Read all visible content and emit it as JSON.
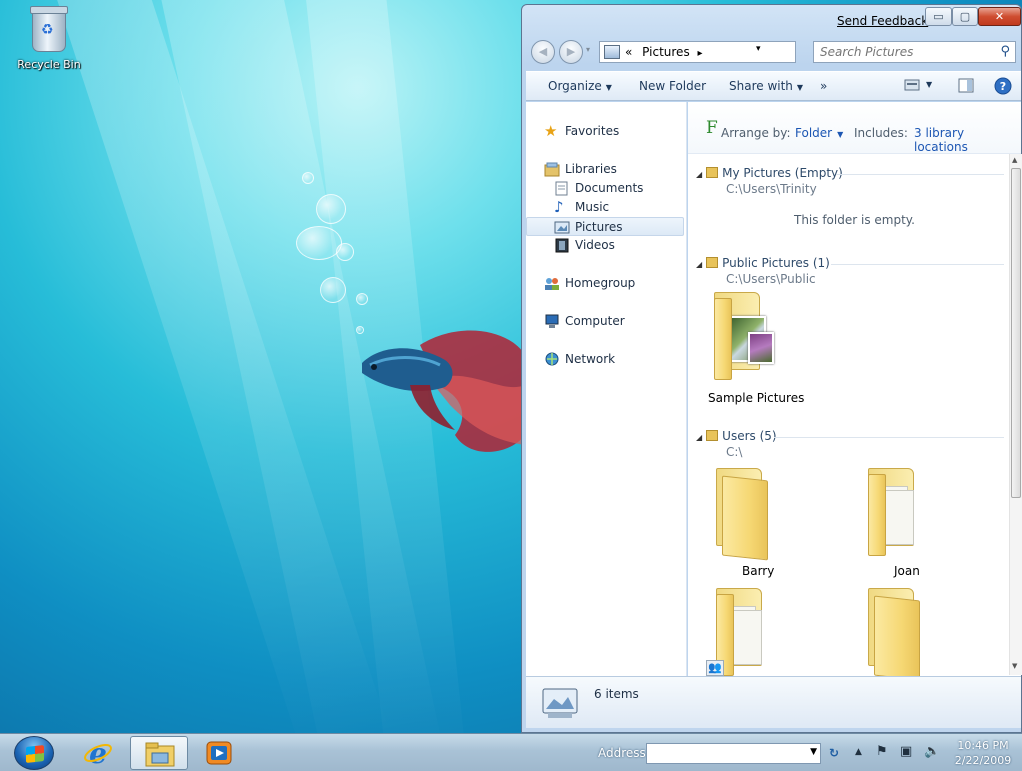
{
  "desktop": {
    "recycle_bin_label": "Recycle Bin"
  },
  "window": {
    "send_feedback": "Send Feedback",
    "caption_buttons": {
      "minimize": "▭",
      "maximize": "▢",
      "close": "✕"
    },
    "nav": {
      "back": "◀",
      "forward": "▶"
    },
    "address": {
      "prefix": "«",
      "location": "Pictures",
      "separator": "▸",
      "dropdown": "▾",
      "refresh": "↻"
    },
    "search": {
      "placeholder": "Search Pictures"
    },
    "toolbar": {
      "organize": "Organize",
      "new_folder": "New Folder",
      "share_with": "Share with",
      "more": "»"
    },
    "nav_pane": {
      "favorites": "Favorites",
      "libraries": "Libraries",
      "documents": "Documents",
      "music": "Music",
      "pictures": "Pictures",
      "videos": "Videos",
      "homegroup": "Homegroup",
      "computer": "Computer",
      "network": "Network"
    },
    "library_header": {
      "letter": "F",
      "arrange_by_label": "Arrange by:",
      "arrange_by_value": "Folder",
      "includes_label": "Includes:",
      "includes_value": "3 library locations"
    },
    "groups": [
      {
        "title": "My Pictures (Empty)",
        "path": "C:\\Users\\Trinity",
        "empty_message": "This folder is empty."
      },
      {
        "title": "Public Pictures (1)",
        "path": "C:\\Users\\Public",
        "items": [
          "Sample Pictures"
        ]
      },
      {
        "title": "Users (5)",
        "path": "C:\\",
        "items": [
          "Barry",
          "Joan"
        ]
      }
    ],
    "status": {
      "item_count": "6 items"
    }
  },
  "taskbar": {
    "address_label": "Address",
    "address_value": "",
    "clock_time": "10:46 PM",
    "clock_date": "2/22/2009"
  },
  "colors": {
    "accent_link": "#1c56b3",
    "close_button": "#c9452a",
    "desktop_top": "#b9f3f6",
    "desktop_bottom": "#0a5e96"
  }
}
